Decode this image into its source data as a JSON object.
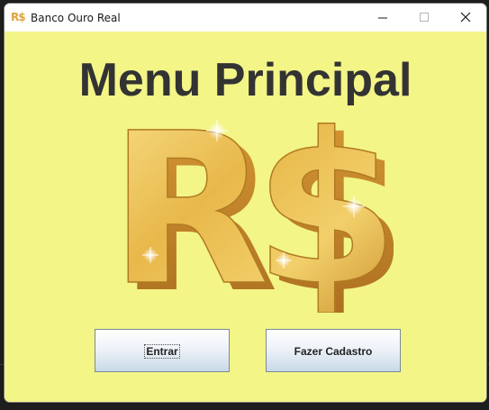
{
  "window": {
    "title": "Banco Ouro Real",
    "icon": "R$",
    "controls": [
      "minimize-icon",
      "maximize-icon",
      "close-icon"
    ]
  },
  "main": {
    "heading": "Menu Principal",
    "logo_text": "R$",
    "logo_color": "#e8b84a",
    "background_color": "#f3f587"
  },
  "buttons": {
    "login_label": "Entrar",
    "register_label": "Fazer Cadastro"
  }
}
